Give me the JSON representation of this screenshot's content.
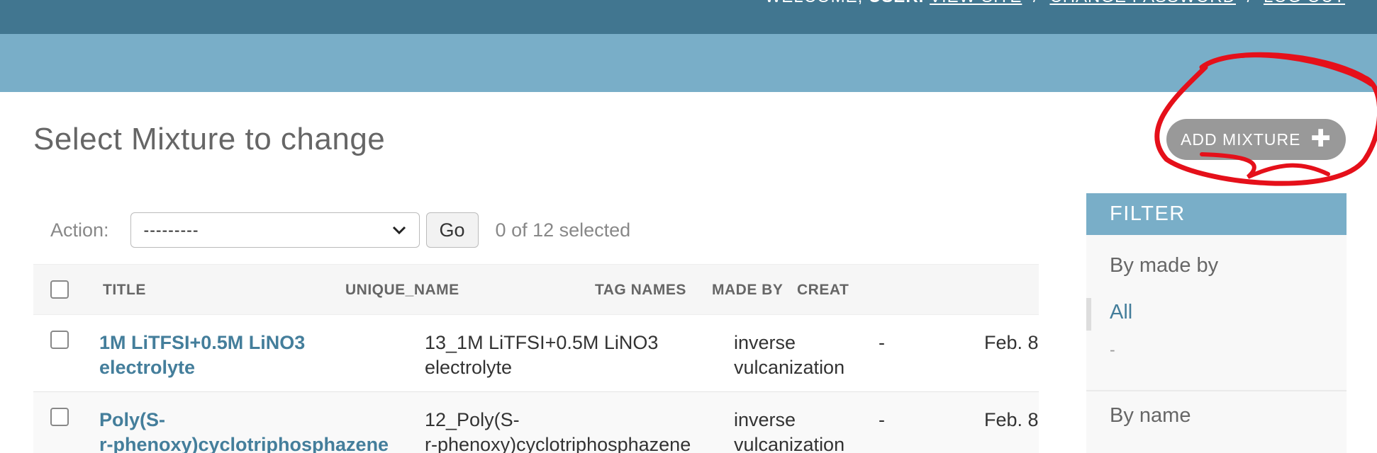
{
  "header": {
    "welcome": "WELCOME,",
    "user": "USER.",
    "view_site": "VIEW SITE",
    "change_password": "CHANGE PASSWORD",
    "log_out": "LOG OUT",
    "separator": "/"
  },
  "page": {
    "title": "Select Mixture to change",
    "add_button": "ADD MIXTURE"
  },
  "actions": {
    "label": "Action:",
    "selected_value": "---------",
    "go_label": "Go",
    "selection_count": "0 of 12 selected"
  },
  "table": {
    "columns": [
      "TITLE",
      "UNIQUE_NAME",
      "TAG NAMES",
      "MADE BY",
      "CREAT"
    ],
    "rows": [
      {
        "title": [
          "1M LiTFSI+0.5M LiNO3",
          "electrolyte"
        ],
        "unique_name": [
          "13_1M LiTFSI+0.5M LiNO3",
          "electrolyte"
        ],
        "tag_names": [
          "inverse",
          "vulcanization"
        ],
        "made_by": "-",
        "created": "Feb. 8"
      },
      {
        "title": [
          "Poly(S-",
          "r-phenoxy)cyclotriphosphazene"
        ],
        "unique_name": [
          "12_Poly(S-",
          "r-phenoxy)cyclotriphosphazene"
        ],
        "tag_names": [
          "inverse",
          "vulcanization"
        ],
        "made_by": "-",
        "created": "Feb. 8"
      }
    ]
  },
  "filter": {
    "heading": "FILTER",
    "sections": [
      {
        "title": "By made by",
        "options": [
          "All",
          "-"
        ]
      },
      {
        "title": "By name"
      }
    ]
  },
  "colors": {
    "header_bg": "#417690",
    "breadcrumb_bg": "#79aec8",
    "link": "#447e9b",
    "add_button_bg": "#999999",
    "annotation": "#e5101a"
  }
}
